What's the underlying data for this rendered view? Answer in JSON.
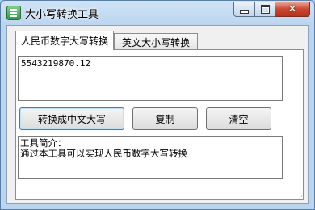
{
  "window": {
    "title": "大小写转换工具"
  },
  "tabs": [
    {
      "label": "人民币数字大写转换",
      "selected": true
    },
    {
      "label": "英文大小写转换",
      "selected": false
    }
  ],
  "amount_input": {
    "value": "5543219870.12"
  },
  "buttons": {
    "convert": "转换成中文大写",
    "copy": "复制",
    "clear": "清空"
  },
  "intro": {
    "line1": "工具简介：",
    "line2": "通过本工具可以实现人民币数字大写转换"
  },
  "title_buttons": {
    "minimize": "minimize",
    "maximize": "maximize",
    "close": "close"
  },
  "colors": {
    "titlebar": "#bcd5ee",
    "close_button": "#c8462f",
    "panel": "#ffffff"
  }
}
